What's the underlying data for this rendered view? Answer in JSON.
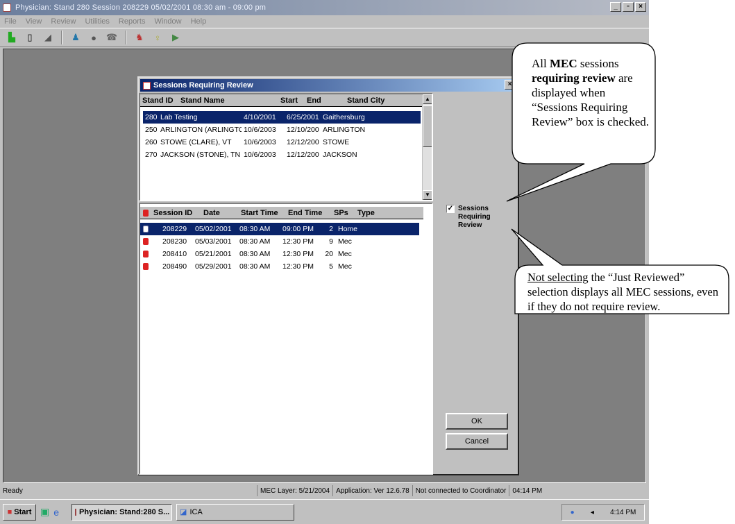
{
  "app": {
    "title": "Physician: Stand 280 Session 208229 05/02/2001 08:30 am - 09:00 pm",
    "menu": [
      "File",
      "View",
      "Review",
      "Utilities",
      "Reports",
      "Window",
      "Help"
    ],
    "toolbar_icons": [
      "new-icon",
      "clipboard-icon",
      "chart-icon",
      "people-icon",
      "globe-icon",
      "phone-icon",
      "person-icon",
      "bulb-icon",
      "exit-icon"
    ]
  },
  "dialog": {
    "title": "Sessions Requiring Review",
    "stands_headers": [
      "Stand ID",
      "Stand Name",
      "Start",
      "End",
      "Stand City"
    ],
    "stands": [
      {
        "id": "280",
        "name": "Lab Testing",
        "start": "4/10/2001",
        "end": "6/25/2001",
        "city": "Gaithersburg",
        "selected": true
      },
      {
        "id": "250",
        "name": "ARLINGTON (ARLINGTO",
        "start": "10/6/2003",
        "end": "12/10/200",
        "city": "ARLINGTON",
        "selected": false
      },
      {
        "id": "260",
        "name": "STOWE (CLARE), VT",
        "start": "10/6/2003",
        "end": "12/12/200",
        "city": "STOWE",
        "selected": false
      },
      {
        "id": "270",
        "name": "JACKSON (STONE), TN",
        "start": "10/6/2003",
        "end": "12/12/200",
        "city": "JACKSON",
        "selected": false
      }
    ],
    "sessions_headers": [
      "Session ID",
      "Date",
      "Start Time",
      "End Time",
      "SPs",
      "Type"
    ],
    "sessions": [
      {
        "id": "208229",
        "date": "05/02/2001",
        "start": "08:30 AM",
        "end": "09:00 PM",
        "sps": "2",
        "type": "Home",
        "selected": true
      },
      {
        "id": "208230",
        "date": "05/03/2001",
        "start": "08:30 AM",
        "end": "12:30 PM",
        "sps": "9",
        "type": "Mec",
        "selected": false
      },
      {
        "id": "208410",
        "date": "05/21/2001",
        "start": "08:30 AM",
        "end": "12:30 PM",
        "sps": "20",
        "type": "Mec",
        "selected": false
      },
      {
        "id": "208490",
        "date": "05/29/2001",
        "start": "08:30 AM",
        "end": "12:30 PM",
        "sps": "5",
        "type": "Mec",
        "selected": false
      }
    ],
    "checkbox_label": "Sessions Requiring Review",
    "checkbox_checked": true,
    "ok_label": "OK",
    "cancel_label": "Cancel"
  },
  "status": {
    "ready": "Ready",
    "mec_layer": "MEC Layer: 5/21/2004",
    "application": "Application: Ver 12.6.78",
    "coordinator": "Not connected to Coordinator",
    "time": "04:14 PM"
  },
  "taskbar": {
    "start": "Start",
    "items": [
      "Physician: Stand:280 S...",
      "ICA"
    ],
    "clock": "4:14 PM"
  },
  "callout1": {
    "word1": "All ",
    "bold1": "MEC",
    "word2": " sessions ",
    "bold2": "requiring review",
    "rest": " are displayed when “Sessions Requiring Review” box is checked."
  },
  "callout2": {
    "u1": "Not selecting",
    "rest": " the “Just Reviewed” selection displays all MEC sessions, even if they do not require review."
  }
}
